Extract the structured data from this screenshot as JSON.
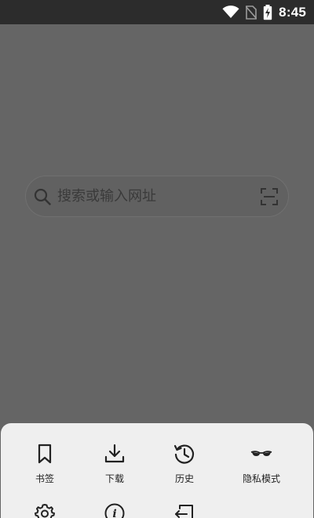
{
  "status_bar": {
    "time": "8:45",
    "icons": [
      "wifi-icon",
      "no-sim-icon",
      "battery-charging-icon"
    ]
  },
  "search": {
    "placeholder": "搜索或输入网址",
    "left_icon": "search-icon",
    "right_icon": "scan-icon"
  },
  "menu": {
    "row1": [
      {
        "label": "书签",
        "icon": "bookmark-icon"
      },
      {
        "label": "下载",
        "icon": "download-icon"
      },
      {
        "label": "历史",
        "icon": "history-icon"
      },
      {
        "label": "隐私模式",
        "icon": "incognito-glasses-icon"
      }
    ],
    "row2": [
      {
        "label": "",
        "icon": "settings-icon"
      },
      {
        "label": "",
        "icon": "info-icon"
      },
      {
        "label": "",
        "icon": "exit-icon"
      }
    ]
  },
  "colors": {
    "background_dim": "#656565",
    "status_bar": "#2c2c2c",
    "sheet": "#efefef",
    "icon": "#222222"
  }
}
